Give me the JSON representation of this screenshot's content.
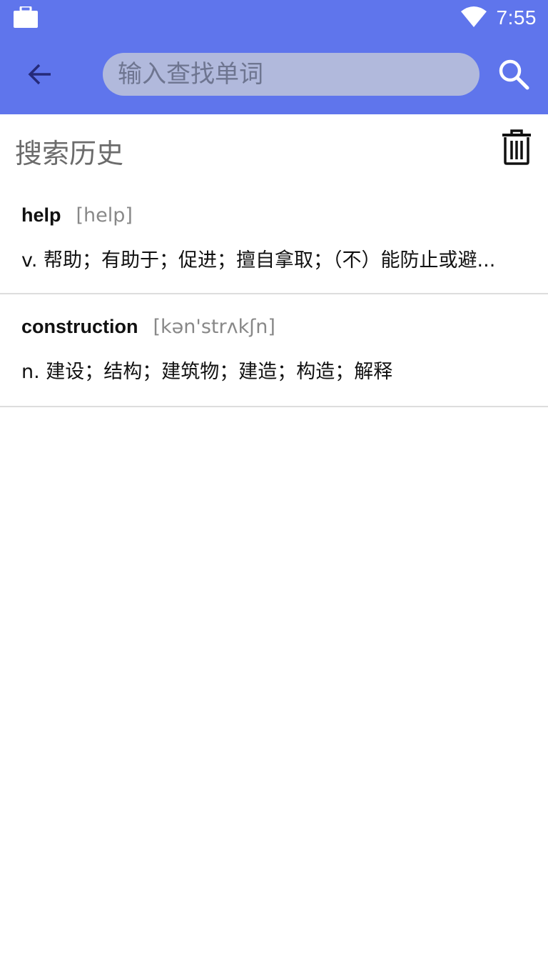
{
  "status_bar": {
    "time": "7:55",
    "icons": [
      "briefcase-icon",
      "wifi-icon"
    ]
  },
  "app_bar": {
    "back_icon": "arrow-left-icon",
    "search_placeholder": "输入查找单词",
    "search_value": "",
    "search_icon": "search-icon",
    "background": "#5f75ec"
  },
  "history": {
    "title": "搜索历史",
    "clear_icon": "trash-icon",
    "items": [
      {
        "word": "help",
        "phonetic": "[help]",
        "definition": "v. 帮助；有助于；促进；擅自拿取；（不）能防止或避..."
      },
      {
        "word": "construction",
        "phonetic": "[kən'strʌkʃn]",
        "definition": "n. 建设；结构；建筑物；建造；构造；解释"
      }
    ]
  }
}
